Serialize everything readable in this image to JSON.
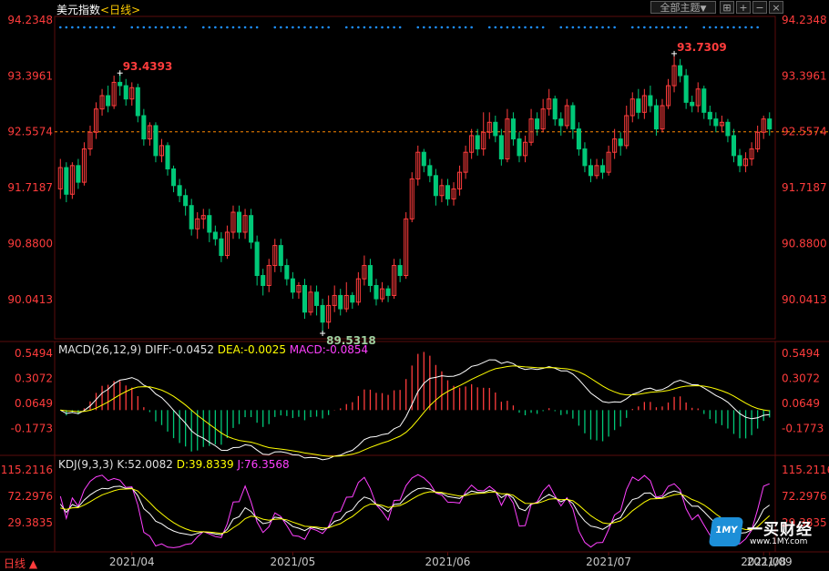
{
  "header": {
    "title": "美元指数",
    "period_label": "<日线>",
    "theme_button": "全部主题",
    "theme_dropdown_arrow": "▼"
  },
  "toolbar": {
    "icons": [
      "crosshair-icon",
      "zoom-in-icon",
      "zoom-out-icon",
      "close-icon"
    ],
    "icon_glyphs": [
      "⊞",
      "+",
      "−",
      "×"
    ]
  },
  "footer": {
    "period_button": "日线 ▲"
  },
  "watermark": {
    "logo_text": "1MY",
    "title": "一买财经",
    "url": "www.1MY.com"
  },
  "colors": {
    "up": "#ff3c3c",
    "down": "#00c878",
    "bg": "#000000",
    "grid": "#3a1010",
    "dif": "#ffffff",
    "dea": "#ffff00",
    "macd_label": "#ff40ff",
    "k": "#ffffff",
    "d": "#ffff00",
    "j": "#ff40ff",
    "dots": "#1e90ff",
    "axis_text": "#ff3c3c",
    "ref_line": "#ff8800"
  },
  "chart_data": [
    {
      "type": "candlestick",
      "name": "price",
      "y_axis_labels": [
        "94.2348",
        "93.3961",
        "92.5574",
        "91.7187",
        "90.8800",
        "90.0413"
      ],
      "ylim": [
        89.45,
        94.29
      ],
      "reference_line": 92.5574,
      "high_annotation": {
        "text": "93.4393",
        "value": 93.4393
      },
      "high_annotation_2": {
        "text": "93.7309",
        "value": 93.7309
      },
      "low_annotation": {
        "text": "89.5318",
        "value": 89.5318
      },
      "x_labels": [
        "2021/04",
        "2021/05",
        "2021/06",
        "2021/07",
        "2021/08",
        "2021/09"
      ],
      "x_label_index": [
        12,
        39,
        65,
        92,
        118,
        144
      ],
      "candles": [
        [
          91.7,
          92.02,
          91.55,
          92.15
        ],
        [
          92.02,
          91.62,
          91.5,
          92.1
        ],
        [
          91.62,
          92.05,
          91.55,
          92.1
        ],
        [
          92.05,
          91.8,
          91.7,
          92.15
        ],
        [
          91.8,
          92.3,
          91.75,
          92.4
        ],
        [
          92.3,
          92.55,
          92.2,
          92.65
        ],
        [
          92.55,
          92.9,
          92.45,
          93.0
        ],
        [
          92.9,
          93.1,
          92.8,
          93.2
        ],
        [
          93.1,
          92.95,
          92.85,
          93.25
        ],
        [
          92.95,
          93.3,
          92.9,
          93.4
        ],
        [
          93.3,
          93.25,
          93.1,
          93.44
        ],
        [
          93.25,
          93.05,
          92.95,
          93.35
        ],
        [
          93.05,
          93.22,
          92.95,
          93.3
        ],
        [
          93.22,
          92.8,
          92.7,
          93.28
        ],
        [
          92.8,
          92.45,
          92.35,
          92.9
        ],
        [
          92.45,
          92.65,
          92.35,
          92.7
        ],
        [
          92.65,
          92.2,
          92.1,
          92.7
        ],
        [
          92.2,
          92.35,
          92.1,
          92.45
        ],
        [
          92.35,
          92.0,
          91.9,
          92.4
        ],
        [
          92.0,
          91.75,
          91.65,
          92.05
        ],
        [
          91.75,
          91.6,
          91.5,
          91.85
        ],
        [
          91.6,
          91.45,
          91.3,
          91.7
        ],
        [
          91.45,
          91.1,
          91.0,
          91.55
        ],
        [
          91.1,
          91.25,
          90.95,
          91.35
        ],
        [
          91.25,
          91.3,
          91.1,
          91.4
        ],
        [
          91.3,
          91.05,
          90.9,
          91.4
        ],
        [
          91.05,
          90.95,
          90.85,
          91.15
        ],
        [
          90.95,
          90.7,
          90.6,
          91.05
        ],
        [
          90.7,
          91.05,
          90.65,
          91.15
        ],
        [
          91.05,
          91.35,
          90.95,
          91.45
        ],
        [
          91.35,
          91.05,
          90.95,
          91.45
        ],
        [
          91.05,
          91.3,
          90.95,
          91.4
        ],
        [
          91.3,
          90.9,
          90.8,
          91.4
        ],
        [
          90.9,
          90.4,
          90.25,
          91.0
        ],
        [
          90.4,
          90.25,
          90.1,
          90.5
        ],
        [
          90.25,
          90.55,
          90.15,
          90.65
        ],
        [
          90.55,
          90.85,
          90.45,
          90.95
        ],
        [
          90.85,
          90.55,
          90.45,
          90.95
        ],
        [
          90.55,
          90.35,
          90.25,
          90.65
        ],
        [
          90.35,
          90.15,
          90.05,
          90.45
        ],
        [
          90.15,
          90.25,
          90.05,
          90.3
        ],
        [
          90.25,
          89.85,
          89.75,
          90.35
        ],
        [
          89.85,
          90.15,
          89.8,
          90.25
        ],
        [
          90.15,
          89.95,
          89.8,
          90.25
        ],
        [
          89.95,
          89.7,
          89.53,
          90.05
        ],
        [
          89.7,
          89.95,
          89.6,
          90.1
        ],
        [
          89.95,
          90.1,
          89.85,
          90.25
        ],
        [
          90.1,
          89.9,
          89.8,
          90.2
        ],
        [
          89.9,
          90.1,
          89.85,
          90.3
        ],
        [
          90.1,
          90.0,
          89.9,
          90.15
        ],
        [
          90.0,
          90.35,
          89.95,
          90.45
        ],
        [
          90.35,
          90.55,
          90.25,
          90.7
        ],
        [
          90.55,
          90.25,
          90.15,
          90.65
        ],
        [
          90.25,
          90.05,
          89.95,
          90.35
        ],
        [
          90.05,
          90.2,
          90.0,
          90.3
        ],
        [
          90.2,
          90.1,
          90.0,
          90.25
        ],
        [
          90.1,
          90.55,
          90.05,
          90.65
        ],
        [
          90.55,
          90.4,
          90.3,
          90.65
        ],
        [
          90.4,
          91.25,
          90.35,
          91.35
        ],
        [
          91.25,
          91.85,
          91.2,
          91.95
        ],
        [
          91.85,
          92.25,
          91.75,
          92.35
        ],
        [
          92.25,
          92.05,
          91.95,
          92.3
        ],
        [
          92.05,
          91.9,
          91.8,
          92.15
        ],
        [
          91.9,
          91.6,
          91.45,
          92.0
        ],
        [
          91.6,
          91.75,
          91.5,
          91.85
        ],
        [
          91.75,
          91.55,
          91.45,
          91.85
        ],
        [
          91.55,
          91.7,
          91.45,
          91.8
        ],
        [
          91.7,
          91.95,
          91.6,
          92.05
        ],
        [
          91.95,
          92.25,
          91.85,
          92.35
        ],
        [
          92.25,
          92.5,
          92.15,
          92.6
        ],
        [
          92.5,
          92.3,
          92.2,
          92.6
        ],
        [
          92.3,
          92.55,
          92.2,
          92.85
        ],
        [
          92.55,
          92.7,
          92.45,
          92.85
        ],
        [
          92.7,
          92.5,
          92.4,
          92.8
        ],
        [
          92.5,
          92.15,
          92.05,
          92.6
        ],
        [
          92.15,
          92.75,
          92.1,
          92.9
        ],
        [
          92.75,
          92.45,
          92.35,
          92.85
        ],
        [
          92.45,
          92.2,
          92.1,
          92.55
        ],
        [
          92.2,
          92.4,
          92.1,
          92.5
        ],
        [
          92.4,
          92.75,
          92.35,
          92.9
        ],
        [
          92.75,
          92.6,
          92.5,
          92.85
        ],
        [
          92.6,
          92.9,
          92.55,
          93.05
        ],
        [
          92.9,
          93.05,
          92.8,
          93.2
        ],
        [
          93.05,
          92.75,
          92.65,
          93.1
        ],
        [
          92.75,
          92.65,
          92.5,
          92.85
        ],
        [
          92.65,
          92.95,
          92.6,
          93.05
        ],
        [
          92.95,
          92.6,
          92.45,
          93.0
        ],
        [
          92.6,
          92.3,
          92.2,
          92.7
        ],
        [
          92.3,
          92.05,
          91.95,
          92.4
        ],
        [
          92.05,
          91.9,
          91.8,
          92.15
        ],
        [
          91.9,
          92.05,
          91.85,
          92.15
        ],
        [
          92.05,
          91.95,
          91.85,
          92.15
        ],
        [
          91.95,
          92.25,
          91.9,
          92.35
        ],
        [
          92.25,
          92.45,
          92.15,
          92.6
        ],
        [
          92.45,
          92.35,
          92.2,
          92.55
        ],
        [
          92.35,
          92.8,
          92.3,
          92.95
        ],
        [
          92.8,
          93.05,
          92.7,
          93.15
        ],
        [
          93.05,
          92.85,
          92.75,
          93.2
        ],
        [
          92.85,
          93.1,
          92.75,
          93.2
        ],
        [
          93.1,
          92.95,
          92.85,
          93.25
        ],
        [
          92.95,
          92.6,
          92.5,
          93.05
        ],
        [
          92.6,
          92.95,
          92.55,
          93.05
        ],
        [
          92.95,
          93.25,
          92.9,
          93.35
        ],
        [
          93.25,
          93.55,
          93.15,
          93.73
        ],
        [
          93.55,
          93.4,
          93.3,
          93.65
        ],
        [
          93.4,
          93.0,
          92.9,
          93.5
        ],
        [
          93.0,
          92.95,
          92.85,
          93.1
        ],
        [
          92.95,
          93.2,
          92.85,
          93.3
        ],
        [
          93.2,
          92.85,
          92.75,
          93.25
        ],
        [
          92.85,
          92.75,
          92.65,
          92.95
        ],
        [
          92.75,
          92.65,
          92.55,
          92.85
        ],
        [
          92.65,
          92.7,
          92.55,
          92.8
        ],
        [
          92.7,
          92.5,
          92.4,
          92.75
        ],
        [
          92.5,
          92.2,
          92.1,
          92.6
        ],
        [
          92.2,
          92.05,
          91.95,
          92.3
        ],
        [
          92.05,
          92.15,
          91.95,
          92.25
        ],
        [
          92.15,
          92.3,
          92.05,
          92.4
        ],
        [
          92.3,
          92.55,
          92.25,
          92.65
        ],
        [
          92.55,
          92.75,
          92.45,
          92.8
        ],
        [
          92.75,
          92.6,
          92.5,
          92.85
        ]
      ]
    },
    {
      "type": "macd",
      "name": "MACD(26,12,9)",
      "labels": {
        "title": "MACD(26,12,9)",
        "dif": "DIFF:-0.0452",
        "dea": "DEA:-0.0025",
        "macd": "MACD:-0.0854"
      },
      "y_axis_labels": [
        "0.5494",
        "0.3072",
        "0.0649",
        "-0.1773"
      ],
      "ylim": [
        -0.42,
        0.62
      ]
    },
    {
      "type": "kdj",
      "name": "KDJ(9,3,3)",
      "labels": {
        "title": "KDJ(9,3,3)",
        "k": "K:52.0082",
        "d": "D:39.8339",
        "j": "J:76.3568"
      },
      "y_axis_labels": [
        "115.2116",
        "72.2976",
        "29.3835"
      ],
      "ylim": [
        -14,
        130
      ]
    }
  ]
}
